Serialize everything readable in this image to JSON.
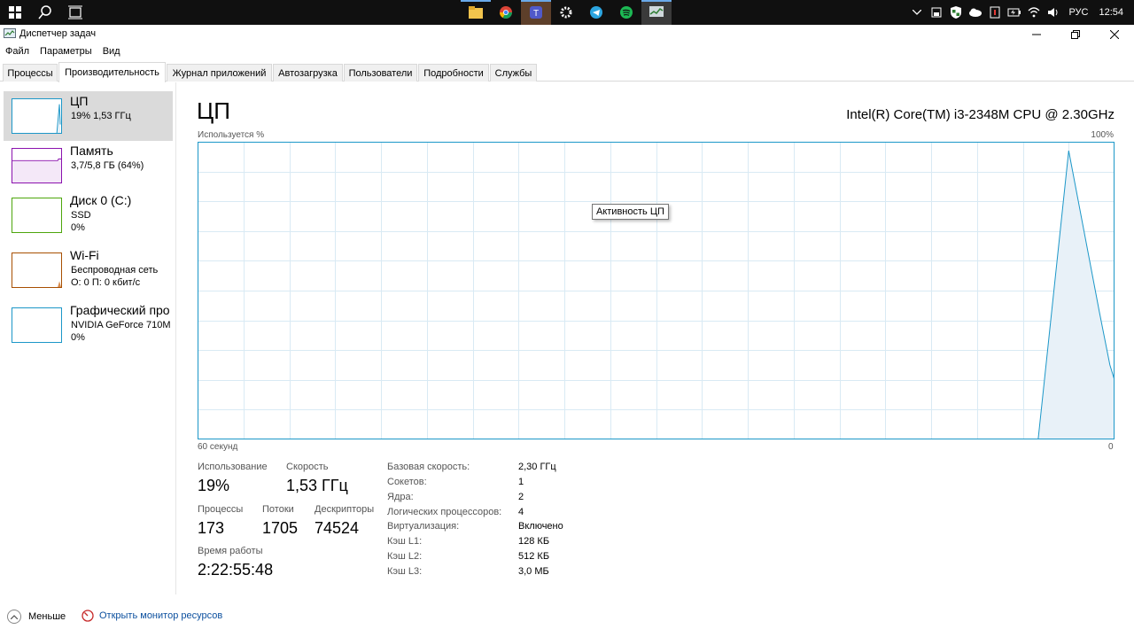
{
  "taskbar": {
    "tray_lang": "РУС",
    "clock": "12:54"
  },
  "window": {
    "title": "Диспетчер задач"
  },
  "menu": [
    "Файл",
    "Параметры",
    "Вид"
  ],
  "tabs": [
    "Процессы",
    "Производительность",
    "Журнал приложений",
    "Автозагрузка",
    "Пользователи",
    "Подробности",
    "Службы"
  ],
  "active_tab": "Производительность",
  "resources": [
    {
      "name": "ЦП",
      "line1": "19%  1,53 ГГц",
      "line2": "",
      "color": "#1c97c8",
      "selected": true
    },
    {
      "name": "Память",
      "line1": "3,7/5,8 ГБ (64%)",
      "line2": "",
      "color": "#8b12ae",
      "selected": false
    },
    {
      "name": "Диск 0 (C:)",
      "line1": "SSD",
      "line2": "0%",
      "color": "#4da60c",
      "selected": false
    },
    {
      "name": "Wi-Fi",
      "line1": "Беспроводная сеть",
      "line2": "О: 0  П: 0 кбит/с",
      "color": "#a74f01",
      "selected": false
    },
    {
      "name": "Графический про",
      "line1": "NVIDIA GeForce 710M",
      "line2": "0%",
      "color": "#1c97c8",
      "selected": false
    }
  ],
  "cpu": {
    "title": "ЦП",
    "model": "Intel(R) Core(TM) i3-2348M CPU @ 2.30GHz",
    "usage_label": "Используется %",
    "max_label": "100%",
    "time_left": "60 секунд",
    "time_right": "0",
    "tooltip": "Активность ЦП",
    "stats": {
      "usage_label": "Использование",
      "usage_value": "19%",
      "speed_label": "Скорость",
      "speed_value": "1,53 ГГц",
      "processes_label": "Процессы",
      "processes_value": "173",
      "threads_label": "Потоки",
      "threads_value": "1705",
      "handles_label": "Дескрипторы",
      "handles_value": "74524",
      "uptime_label": "Время работы",
      "uptime_value": "2:22:55:48"
    },
    "specs": [
      {
        "label": "Базовая скорость:",
        "value": "2,30 ГГц"
      },
      {
        "label": "Сокетов:",
        "value": "1"
      },
      {
        "label": "Ядра:",
        "value": "2"
      },
      {
        "label": "Логических процессоров:",
        "value": "4"
      },
      {
        "label": "Виртуализация:",
        "value": "Включено"
      },
      {
        "label": "Кэш L1:",
        "value": "128 КБ"
      },
      {
        "label": "Кэш L2:",
        "value": "512 КБ"
      },
      {
        "label": "Кэш L3:",
        "value": "3,0 МБ"
      }
    ]
  },
  "chart_data": {
    "type": "area",
    "x": [
      60,
      5,
      3,
      1,
      0.3,
      0
    ],
    "values": [
      0,
      0,
      97,
      43,
      25,
      20
    ],
    "xlim": [
      60,
      0
    ],
    "ylim": [
      0,
      100
    ],
    "grid": true,
    "color": "#1c97c8",
    "fill": "#e8f1f8",
    "xlabel": "60 секунд",
    "ylabel": "Используется %"
  },
  "bottom": {
    "fewer_label": "Меньше",
    "monitor_label": "Открыть монитор ресурсов"
  }
}
